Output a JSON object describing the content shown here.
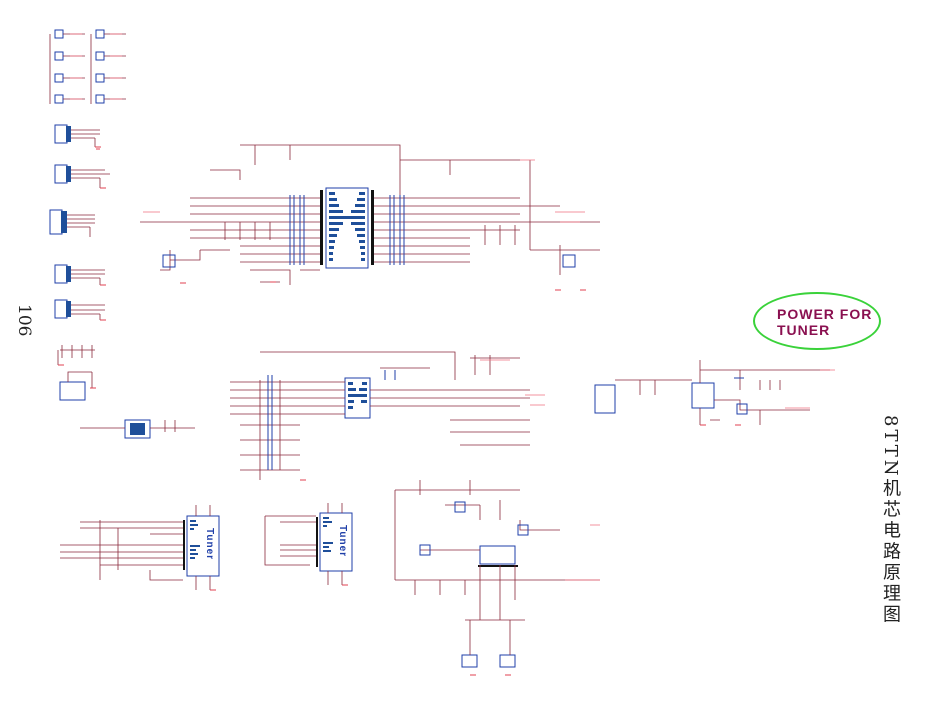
{
  "page_number": "106",
  "document_title": "8TTN机芯电路原理图",
  "annotation": {
    "text": "POWER FOR TUNER",
    "line1": "POWER FOR",
    "line2": "TUNER",
    "ellipse_color": "#3ad23a",
    "text_color": "#8a1050"
  },
  "tuners": [
    {
      "label": "Tuner"
    },
    {
      "label": "Tuner"
    }
  ],
  "colors": {
    "wire": "#8a2a3c",
    "component": "#1f3fa8",
    "net_label": "#f07080",
    "ground": "#e04050"
  }
}
